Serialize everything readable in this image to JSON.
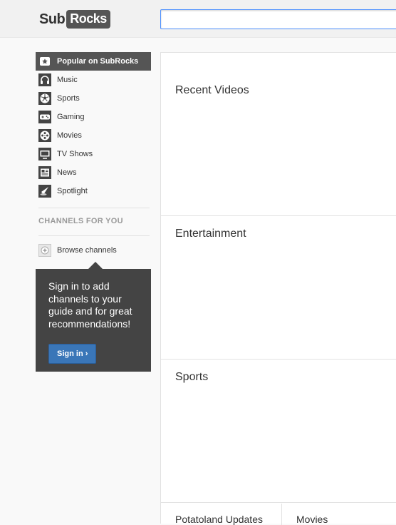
{
  "logo": {
    "part1": "Sub",
    "part2": "Rocks"
  },
  "search": {
    "value": "",
    "placeholder": ""
  },
  "guide": {
    "items": [
      {
        "label": "Popular on SubRocks",
        "icon": "star-icon",
        "active": true
      },
      {
        "label": "Music",
        "icon": "headphones-icon"
      },
      {
        "label": "Sports",
        "icon": "soccer-ball-icon"
      },
      {
        "label": "Gaming",
        "icon": "gamepad-icon"
      },
      {
        "label": "Movies",
        "icon": "film-reel-icon"
      },
      {
        "label": "TV Shows",
        "icon": "tv-icon"
      },
      {
        "label": "News",
        "icon": "newspaper-icon"
      },
      {
        "label": "Spotlight",
        "icon": "spotlight-icon"
      }
    ],
    "channels_header": "CHANNELS FOR YOU",
    "browse_channels": {
      "label": "Browse channels",
      "icon": "plus-icon"
    }
  },
  "signin": {
    "message": "Sign in to add channels to your guide and for great recommendations!",
    "button": "Sign in ›"
  },
  "shelves": [
    {
      "title": "Recent Videos"
    },
    {
      "title": "Entertainment"
    },
    {
      "title": "Sports"
    }
  ],
  "bottom_cells": [
    {
      "label": "Potatoland Updates"
    },
    {
      "label": "Movies"
    }
  ],
  "colors": {
    "accent_button": "#3a76b8",
    "active_nav": "#555555",
    "signin_box": "#444444",
    "search_focus": "#4d90fe"
  }
}
